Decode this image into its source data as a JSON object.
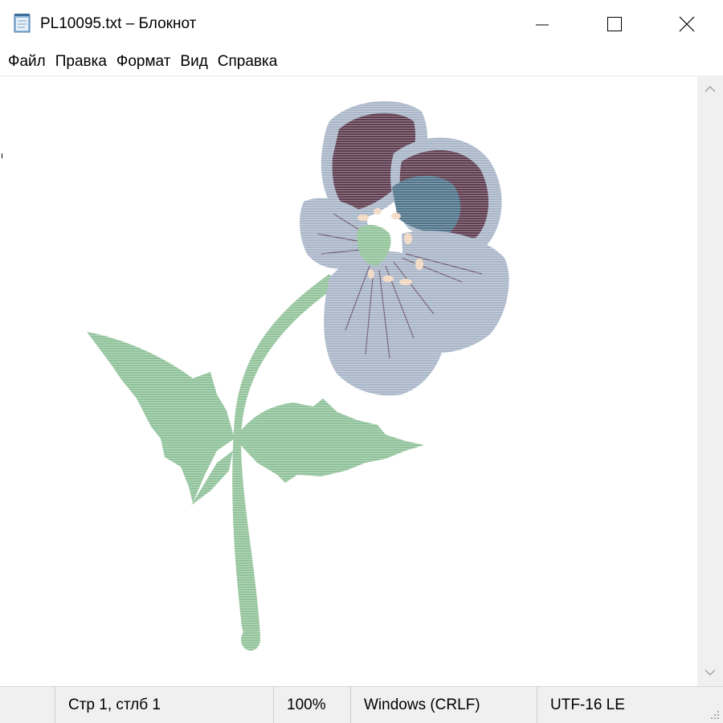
{
  "window": {
    "title": "PL10095.txt – Блокнот",
    "app_icon": "notepad-icon",
    "controls": [
      "minimize-icon",
      "maximize-icon",
      "close-icon"
    ]
  },
  "menu": {
    "items": [
      {
        "label": "Файл"
      },
      {
        "label": "Правка"
      },
      {
        "label": "Формат"
      },
      {
        "label": "Вид"
      },
      {
        "label": "Справка"
      }
    ]
  },
  "editor": {
    "content_description_icon": "pansy-flower-icon",
    "colors": {
      "petal_dark": "#5e3d50",
      "petal_light": "#a9b6c8",
      "petal_center": "#4f7389",
      "stem": "#92c39a",
      "leaf": "#8fc29a",
      "stamen": "#f2d7c0"
    }
  },
  "scrollbar": {
    "up_icon": "chevron-up-icon",
    "down_icon": "chevron-down-icon"
  },
  "status": {
    "position": "Стр 1, стлб 1",
    "zoom": "100%",
    "line_endings": "Windows (CRLF)",
    "encoding": "UTF-16 LE"
  }
}
